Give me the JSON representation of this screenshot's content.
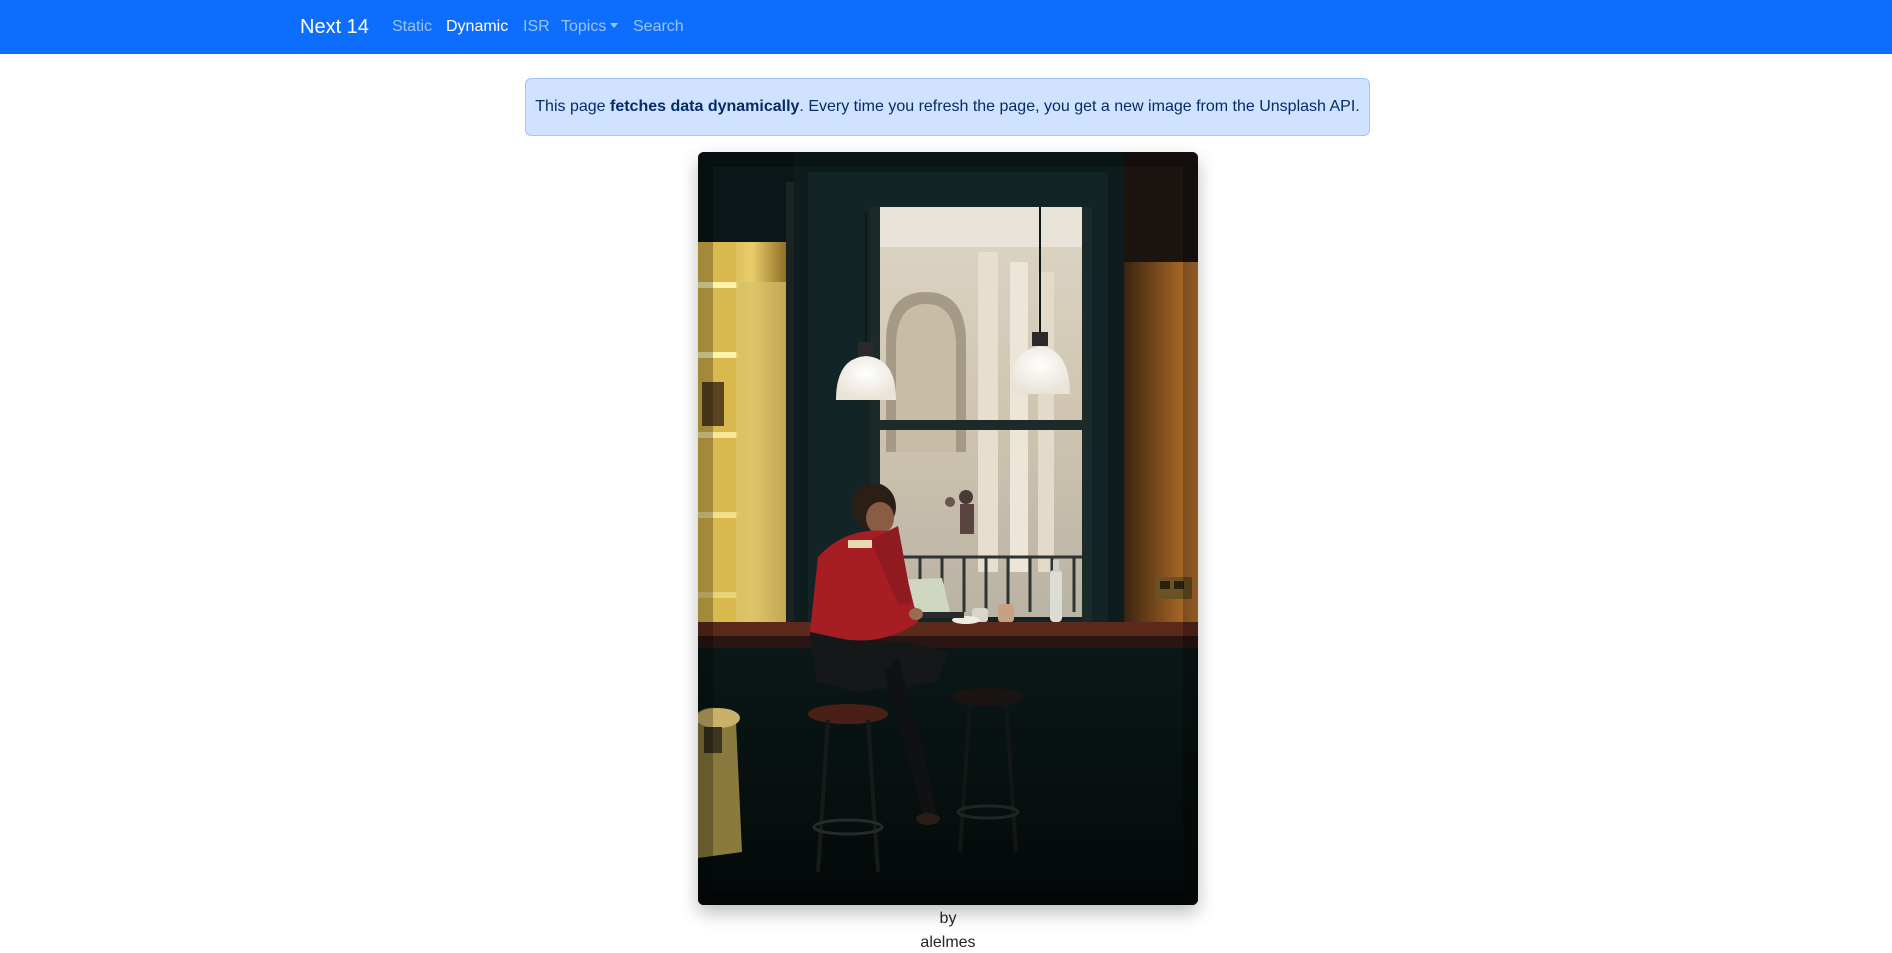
{
  "navbar": {
    "brand": "Next 14",
    "links": [
      {
        "label": "Static",
        "active": false
      },
      {
        "label": "Dynamic",
        "active": true
      },
      {
        "label": "ISR",
        "active": false
      },
      {
        "label": "Topics",
        "active": false,
        "dropdown": true
      },
      {
        "label": "Search",
        "active": false
      }
    ],
    "background_color": "#0d6efd"
  },
  "alert": {
    "prefix": "This page ",
    "emphasis": "fetches data dynamically",
    "suffix": ". Every time you refresh the page, you get a new image from the Unsplash API.",
    "background_color": "#cfe2ff",
    "text_color": "#052c65"
  },
  "photo": {
    "subject": "man in red sweater working on laptop by cafe window with pendant lamps"
  },
  "caption": {
    "by": "by",
    "username": "alelmes"
  }
}
